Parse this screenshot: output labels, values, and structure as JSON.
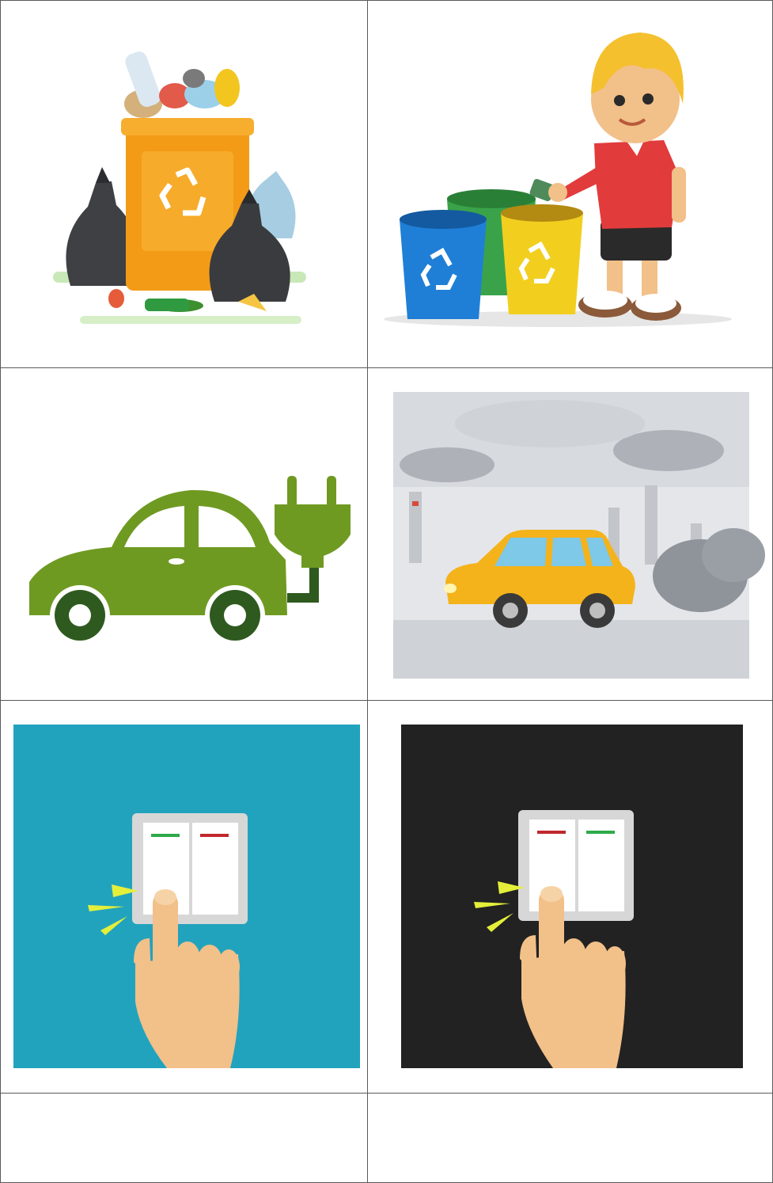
{
  "cards": [
    {
      "icon": "overflowing-trash-bin-icon"
    },
    {
      "icon": "boy-recycling-icon"
    },
    {
      "icon": "electric-car-icon"
    },
    {
      "icon": "polluting-car-icon"
    },
    {
      "icon": "light-switch-on-icon"
    },
    {
      "icon": "light-switch-off-icon"
    },
    {
      "icon": ""
    },
    {
      "icon": ""
    }
  ],
  "colors": {
    "grid_line": "#5a5a5a",
    "bin_orange": "#f39b17",
    "bin_blue": "#1f7fd6",
    "bin_green": "#3aa34a",
    "bin_yellow": "#f2cf1f",
    "ev_green": "#6f9a22",
    "ev_dark": "#2f5a1f",
    "taxi_yellow": "#f4b31a",
    "smog_gray": "#bfc3c8",
    "switch_blue_bg": "#22a3bd",
    "switch_dark_bg": "#222222",
    "indicator_green": "#2eaa4a",
    "indicator_red": "#c0282d",
    "skin": "#f2c089"
  }
}
